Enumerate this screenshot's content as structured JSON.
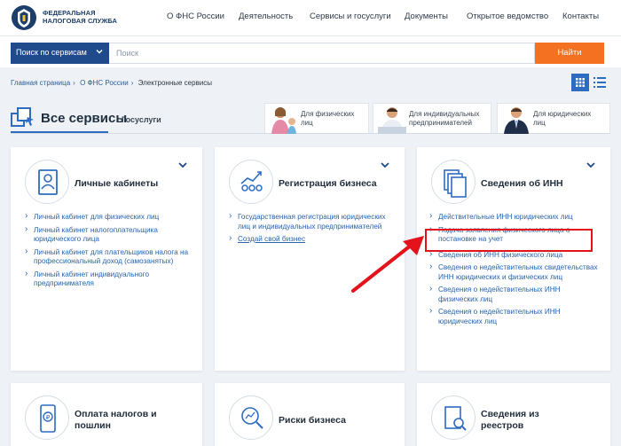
{
  "header": {
    "logo_line1": "ФЕДЕРАЛЬНАЯ",
    "logo_line2": "НАЛОГОВАЯ СЛУЖБА",
    "nav": [
      "О ФНС России",
      "Деятельность",
      "Сервисы и госуслуги",
      "Документы",
      "Открытое ведомство",
      "Контакты"
    ]
  },
  "search": {
    "scope_label": "Поиск по сервисам",
    "placeholder": "Поиск",
    "button_label": "Найти"
  },
  "breadcrumb": [
    "Главная страница",
    "О ФНС России",
    "Электронные сервисы"
  ],
  "tabs": {
    "all_services": "Все сервисы",
    "gosuslugi": "Госуслуги",
    "individuals": [
      "Для физических",
      "лиц"
    ],
    "entrepreneurs": [
      "Для индивидуальных",
      "предпринимателей"
    ],
    "legal": [
      "Для юридических",
      "лиц"
    ]
  },
  "cards": {
    "cabinets": {
      "title": "Личные кабинеты",
      "links": [
        "Личный кабинет для физических лиц",
        "Личный кабинет налогоплательщика юридического лица",
        "Личный кабинет для плательщиков налога на профессиональный доход (самозанятых)",
        "Личный кабинет индивидуального предпринимателя"
      ]
    },
    "business": {
      "title": "Регистрация бизнеса",
      "links": [
        "Государственная регистрация юридических лиц и индивидуальных предпринимателей",
        "Создай свой бизнес"
      ]
    },
    "inn": {
      "title": "Сведения об ИНН",
      "links": [
        "Действительные ИНН юридических лиц",
        "Подача заявления физического лица о постановке на учет",
        "Сведения об ИНН физического лица",
        "Сведения о недействительных свидетельствах ИНН юридических и физических лиц",
        "Сведения о недействительных ИНН физических лиц",
        "Сведения о недействительных ИНН юридических лиц"
      ]
    },
    "taxes": {
      "title_line1": "Оплата налогов и",
      "title_line2": "пошлин"
    },
    "risks": {
      "title": "Риски бизнеса"
    },
    "registers": {
      "title_line1": "Сведения из",
      "title_line2": "реестров"
    }
  },
  "colors": {
    "accent_blue": "#2d6cc0",
    "link_blue": "#2763b0",
    "search_button": "#f47121",
    "highlight_red": "#e3121b"
  }
}
